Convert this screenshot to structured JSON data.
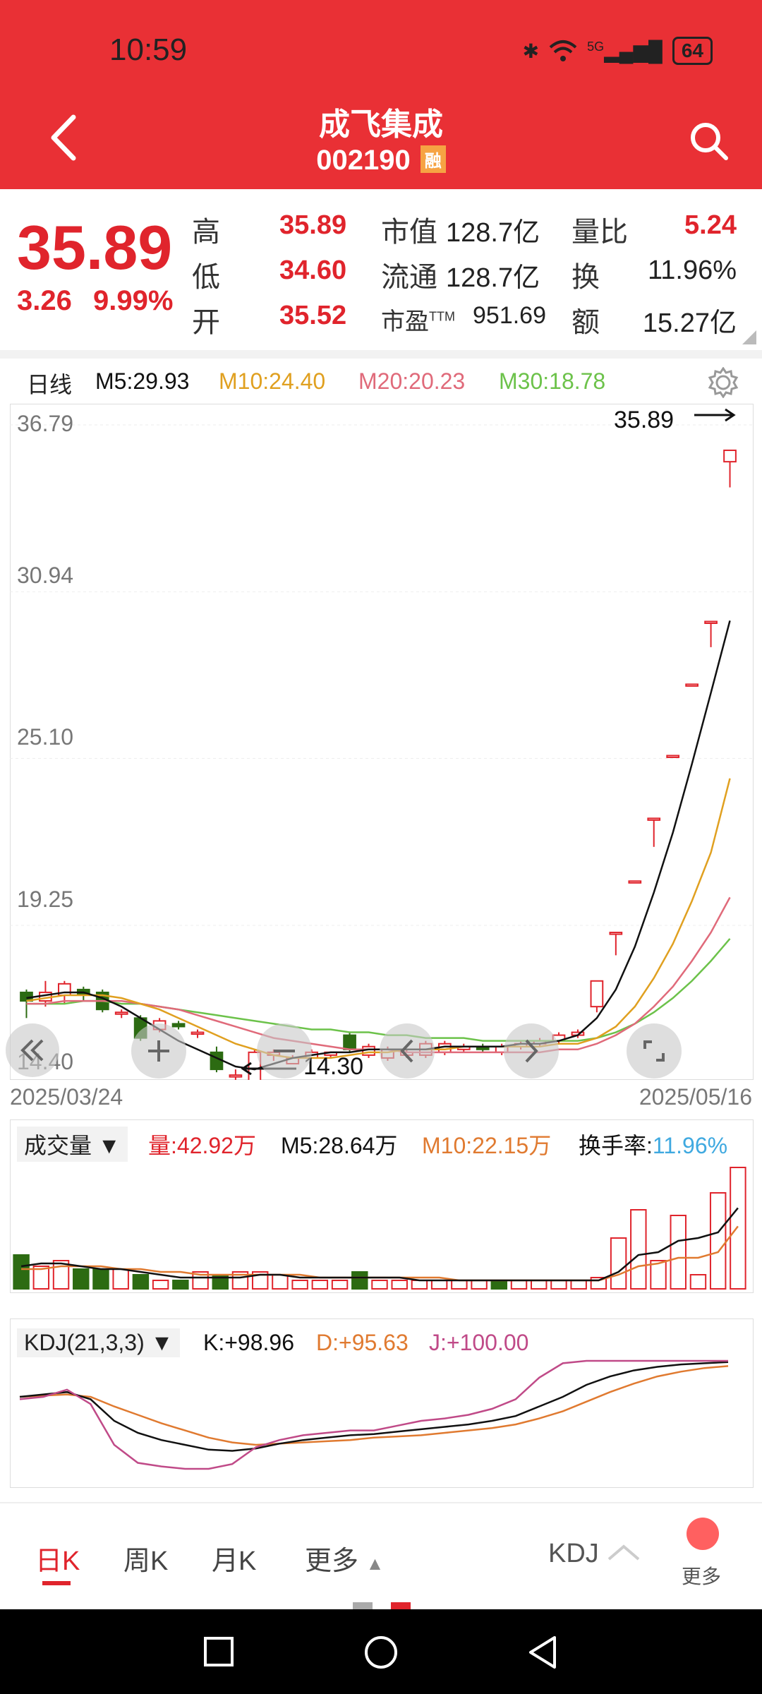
{
  "status": {
    "time": "10:59",
    "battery": "64",
    "signal": "5G"
  },
  "header": {
    "name": "成飞集成",
    "code": "002190",
    "badge": "融"
  },
  "quote": {
    "price": "35.89",
    "change": "3.26",
    "change_pct": "9.99%",
    "high_label": "高",
    "high": "35.89",
    "low_label": "低",
    "low": "34.60",
    "open_label": "开",
    "open": "35.52",
    "mcap_label": "市值",
    "mcap": "128.7亿",
    "float_label": "流通",
    "float": "128.7亿",
    "pe_label": "市盈",
    "pe_sup": "TTM",
    "pe": "951.69",
    "vol_ratio_label": "量比",
    "vol_ratio": "5.24",
    "turnover_label": "换",
    "turnover": "11.96%",
    "amount_label": "额",
    "amount": "15.27亿"
  },
  "ma_legend": {
    "period": "日线",
    "m5": "M5:29.93",
    "m10": "M10:24.40",
    "m20": "M20:20.23",
    "m30": "M30:18.78"
  },
  "colors": {
    "up": "#e0242c",
    "down": "#2c6b12",
    "m5": "#111111",
    "m10": "#e0a020",
    "m20": "#e06a7a",
    "m30": "#6cc24a",
    "brand": "#e93035"
  },
  "chart_data": [
    {
      "type": "candlestick",
      "x_start": "2025/03/24",
      "x_end": "2025/05/16",
      "y_ticks": [
        "36.79",
        "30.94",
        "25.10",
        "19.25"
      ],
      "y_bottom_label": "14.40",
      "ylim": [
        14.4,
        36.79
      ],
      "high_marker": "35.89",
      "low_marker": "14.30",
      "candles": [
        {
          "o": 16.9,
          "c": 16.6,
          "h": 17.0,
          "l": 16.0
        },
        {
          "o": 16.6,
          "c": 16.9,
          "h": 17.3,
          "l": 16.4
        },
        {
          "o": 16.8,
          "c": 17.2,
          "h": 17.3,
          "l": 16.5
        },
        {
          "o": 17.0,
          "c": 16.8,
          "h": 17.1,
          "l": 16.6
        },
        {
          "o": 16.9,
          "c": 16.3,
          "h": 17.0,
          "l": 16.2
        },
        {
          "o": 16.2,
          "c": 16.2,
          "h": 16.3,
          "l": 16.0
        },
        {
          "o": 16.0,
          "c": 15.3,
          "h": 16.1,
          "l": 15.2
        },
        {
          "o": 15.6,
          "c": 15.9,
          "h": 16.0,
          "l": 15.5
        },
        {
          "o": 15.8,
          "c": 15.7,
          "h": 15.9,
          "l": 15.6
        },
        {
          "o": 15.5,
          "c": 15.5,
          "h": 15.6,
          "l": 15.3
        },
        {
          "o": 14.8,
          "c": 14.2,
          "h": 15.0,
          "l": 14.1
        },
        {
          "o": 14.0,
          "c": 14.0,
          "h": 14.2,
          "l": 13.8
        },
        {
          "o": 13.8,
          "c": 14.8,
          "h": 14.9,
          "l": 13.5
        },
        {
          "o": 14.7,
          "c": 14.8,
          "h": 14.9,
          "l": 14.5
        },
        {
          "o": 14.4,
          "c": 14.6,
          "h": 14.7,
          "l": 14.4
        },
        {
          "o": 14.6,
          "c": 14.8,
          "h": 14.9,
          "l": 14.6
        },
        {
          "o": 14.7,
          "c": 14.8,
          "h": 14.8,
          "l": 14.6
        },
        {
          "o": 15.4,
          "c": 14.9,
          "h": 15.5,
          "l": 14.8
        },
        {
          "o": 14.7,
          "c": 15.0,
          "h": 15.1,
          "l": 14.6
        },
        {
          "o": 14.6,
          "c": 14.9,
          "h": 15.0,
          "l": 14.5
        },
        {
          "o": 14.7,
          "c": 14.8,
          "h": 14.9,
          "l": 14.6
        },
        {
          "o": 14.7,
          "c": 15.1,
          "h": 15.2,
          "l": 14.6
        },
        {
          "o": 14.8,
          "c": 15.1,
          "h": 15.2,
          "l": 14.7
        },
        {
          "o": 14.9,
          "c": 15.0,
          "h": 15.1,
          "l": 14.8
        },
        {
          "o": 15.0,
          "c": 14.9,
          "h": 15.1,
          "l": 14.8
        },
        {
          "o": 14.8,
          "c": 15.0,
          "h": 15.1,
          "l": 14.7
        },
        {
          "o": 15.0,
          "c": 15.1,
          "h": 15.2,
          "l": 14.9
        },
        {
          "o": 15.1,
          "c": 15.2,
          "h": 15.3,
          "l": 15.0
        },
        {
          "o": 15.2,
          "c": 15.4,
          "h": 15.5,
          "l": 15.1
        },
        {
          "o": 15.4,
          "c": 15.5,
          "h": 15.6,
          "l": 15.3
        },
        {
          "o": 16.4,
          "c": 17.3,
          "h": 17.3,
          "l": 16.2
        },
        {
          "o": 19.0,
          "c": 19.0,
          "h": 19.0,
          "l": 18.2
        },
        {
          "o": 20.8,
          "c": 20.8,
          "h": 20.8,
          "l": 20.8
        },
        {
          "o": 23.0,
          "c": 23.0,
          "h": 23.0,
          "l": 22.0
        },
        {
          "o": 25.2,
          "c": 25.2,
          "h": 25.2,
          "l": 25.2
        },
        {
          "o": 27.7,
          "c": 27.7,
          "h": 27.7,
          "l": 27.7
        },
        {
          "o": 29.9,
          "c": 29.9,
          "h": 29.9,
          "l": 29.0
        },
        {
          "o": 35.5,
          "c": 35.9,
          "h": 35.9,
          "l": 34.6
        }
      ],
      "m5": [
        16.7,
        16.8,
        16.9,
        16.9,
        16.7,
        16.4,
        16.0,
        15.6,
        15.2,
        14.9,
        14.6,
        14.3,
        14.2,
        14.4,
        14.6,
        14.7,
        14.8,
        14.8,
        14.9,
        14.9,
        14.9,
        14.9,
        15.0,
        15.0,
        15.0,
        15.0,
        15.1,
        15.1,
        15.2,
        15.4,
        16.0,
        17.0,
        18.5,
        20.4,
        22.5,
        24.9,
        27.4,
        29.93
      ],
      "m10": [
        16.6,
        16.7,
        16.8,
        16.8,
        16.8,
        16.7,
        16.5,
        16.3,
        16.0,
        15.7,
        15.4,
        15.1,
        14.9,
        14.7,
        14.6,
        14.6,
        14.6,
        14.7,
        14.8,
        14.8,
        14.9,
        14.9,
        14.9,
        15.0,
        15.0,
        15.0,
        15.0,
        15.0,
        15.1,
        15.1,
        15.3,
        15.7,
        16.4,
        17.4,
        18.6,
        20.1,
        21.8,
        24.4
      ],
      "m20": [
        16.5,
        16.5,
        16.6,
        16.6,
        16.6,
        16.6,
        16.5,
        16.4,
        16.3,
        16.1,
        15.9,
        15.7,
        15.5,
        15.3,
        15.2,
        15.1,
        15.0,
        14.9,
        14.9,
        14.9,
        14.8,
        14.8,
        14.8,
        14.8,
        14.8,
        14.8,
        14.8,
        14.8,
        14.9,
        14.9,
        15.1,
        15.4,
        15.8,
        16.4,
        17.1,
        18.0,
        19.0,
        20.23
      ],
      "m30": [
        16.5,
        16.5,
        16.5,
        16.6,
        16.6,
        16.5,
        16.5,
        16.4,
        16.3,
        16.2,
        16.1,
        16.0,
        15.9,
        15.8,
        15.7,
        15.6,
        15.6,
        15.5,
        15.5,
        15.4,
        15.4,
        15.3,
        15.3,
        15.3,
        15.2,
        15.2,
        15.2,
        15.2,
        15.2,
        15.2,
        15.3,
        15.5,
        15.8,
        16.2,
        16.7,
        17.3,
        18.0,
        18.78
      ]
    },
    {
      "type": "bar",
      "title": "成交量",
      "vol_label": "量:42.92万",
      "m5_label": "M5:28.64万",
      "m10_label": "M10:22.15万",
      "turnover_label": "换手率:",
      "turnover_value": "11.96%",
      "values": [
        12,
        8,
        10,
        7,
        7,
        7,
        5,
        3,
        3,
        6,
        5,
        6,
        6,
        5,
        3,
        3,
        3,
        6,
        3,
        3,
        3,
        3,
        3,
        3,
        3,
        3,
        3,
        3,
        3,
        4,
        18,
        28,
        10,
        26,
        5,
        34,
        43
      ],
      "m5": [
        8,
        9,
        9,
        8,
        7,
        7,
        6,
        5,
        4,
        4,
        4,
        4,
        5,
        5,
        4,
        4,
        4,
        4,
        4,
        4,
        3,
        3,
        3,
        3,
        3,
        3,
        3,
        3,
        3,
        3,
        6,
        12,
        13,
        17,
        18,
        20,
        28.64
      ],
      "m10": [
        7,
        7,
        8,
        8,
        8,
        7,
        7,
        6,
        6,
        5,
        5,
        5,
        5,
        5,
        5,
        4,
        4,
        4,
        4,
        4,
        4,
        4,
        3,
        3,
        3,
        3,
        3,
        3,
        3,
        3,
        5,
        8,
        9,
        11,
        11,
        13,
        22.15
      ]
    },
    {
      "type": "line",
      "title": "KDJ(21,3,3)",
      "k_label": "K:+98.96",
      "d_label": "D:+95.63",
      "j_label": "J:+100.00",
      "k": [
        70,
        72,
        74,
        68,
        50,
        40,
        34,
        30,
        26,
        25,
        27,
        31,
        34,
        36,
        38,
        39,
        41,
        43,
        45,
        47,
        50,
        54,
        62,
        70,
        80,
        87,
        92,
        95,
        97,
        98,
        98.96
      ],
      "d": [
        70,
        71,
        72,
        70,
        62,
        55,
        48,
        42,
        36,
        32,
        30,
        31,
        32,
        33,
        34,
        36,
        37,
        38,
        40,
        42,
        44,
        47,
        52,
        58,
        66,
        74,
        81,
        87,
        91,
        94,
        95.63
      ],
      "j": [
        68,
        70,
        76,
        64,
        30,
        15,
        12,
        10,
        10,
        14,
        28,
        34,
        38,
        40,
        42,
        42,
        46,
        50,
        52,
        55,
        60,
        68,
        86,
        98,
        100,
        100,
        100,
        100,
        100,
        100,
        100
      ]
    }
  ],
  "tabs": [
    {
      "label": "日K"
    },
    {
      "label": "周K"
    },
    {
      "label": "月K"
    },
    {
      "label": "更多"
    }
  ],
  "indicator_select": "KDJ",
  "more_label": "更多"
}
